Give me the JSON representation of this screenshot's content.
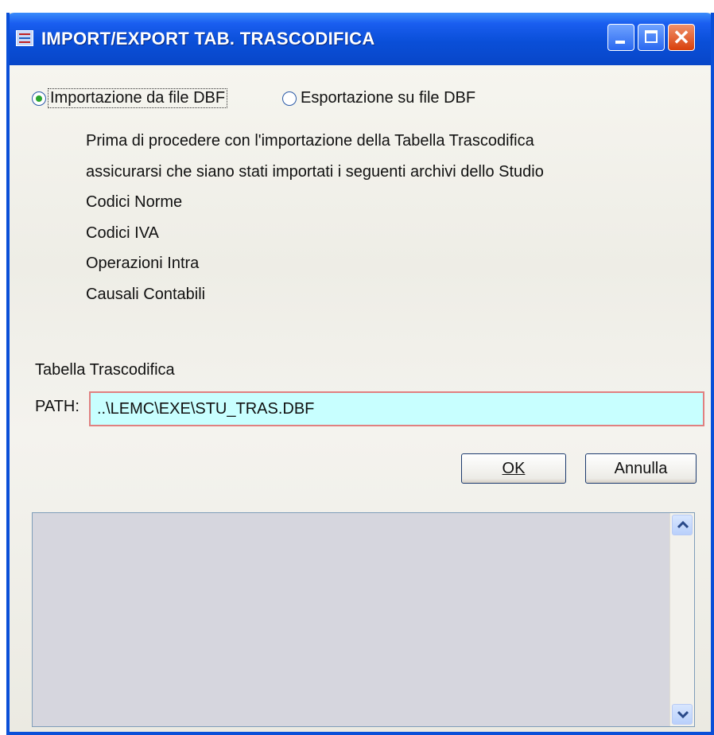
{
  "window": {
    "title": "IMPORT/EXPORT TAB. TRASCODIFICA",
    "close_glyph": "✕"
  },
  "mode": {
    "options": [
      {
        "label": "Importazione da file DBF",
        "checked": true
      },
      {
        "label": "Esportazione su file DBF",
        "checked": false
      }
    ]
  },
  "info": {
    "lines": [
      "Prima di procedere con l'importazione della Tabella Trascodifica",
      "assicurarsi che siano stati importati i seguenti archivi dello Studio",
      "Codici Norme",
      "Codici IVA",
      "Operazioni Intra",
      "Causali Contabili"
    ]
  },
  "table": {
    "label": "Tabella Trascodifica",
    "path_label": "PATH:",
    "path_value": "..\\LEMC\\EXE\\STU_TRAS.DBF"
  },
  "buttons": {
    "ok": "OK",
    "cancel": "Annulla"
  },
  "colors": {
    "titlebar": "#0a4fd8",
    "input_bg": "#c8ffff",
    "input_border": "#e08080",
    "log_bg": "#d6d6de"
  },
  "icons": {
    "app": "table-icon",
    "minimize": "minimize-icon",
    "maximize": "maximize-icon",
    "close": "close-icon",
    "scroll_up": "scroll-up-arrow-icon",
    "scroll_down": "scroll-down-arrow-icon"
  }
}
